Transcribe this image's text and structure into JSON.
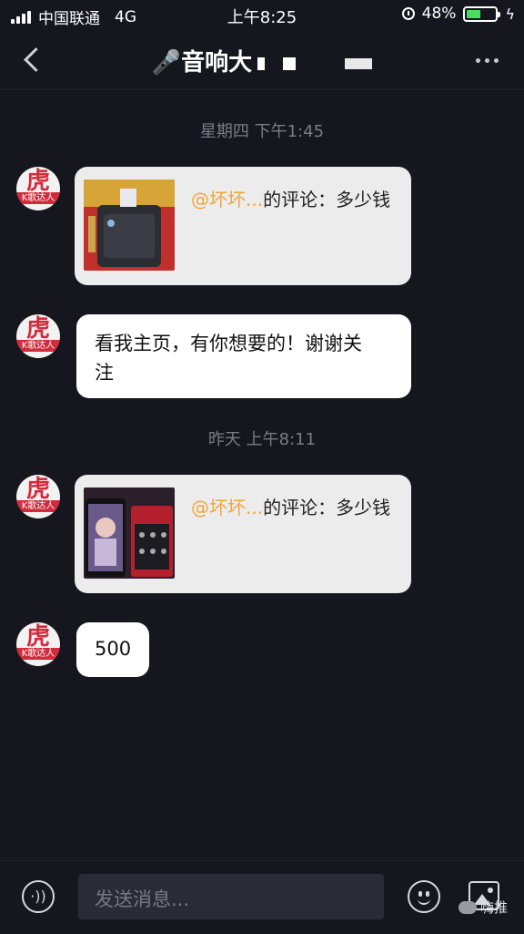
{
  "status_bar": {
    "carrier": "中国联通",
    "network": "4G",
    "time": "上午8:25",
    "battery_percent": "48%",
    "battery_level": 0.48
  },
  "nav": {
    "title": "🎤音响大",
    "back_icon": "chevron-left-icon",
    "more_icon": "more-dots-icon"
  },
  "messages": {
    "ts1": "星期四 下午1:45",
    "c1_mention": "@坏坏...",
    "c1_text": "的评论：多少钱",
    "m2_text_line1": "看我主页，有你想要的！谢谢关",
    "m2_text_line2": "注",
    "ts2": "昨天 上午8:11",
    "c2_mention": "@坏坏...",
    "c2_text": "的评论：多少钱",
    "m4_text": "500"
  },
  "avatar": {
    "big": "虎",
    "band": "K歌达人"
  },
  "input": {
    "placeholder": "发送消息..."
  },
  "watermark": "嗨推",
  "colors": {
    "background": "#16161f",
    "mention": "#f0a43a",
    "avatar_brand": "#d22b3c",
    "battery": "#4cd964"
  }
}
